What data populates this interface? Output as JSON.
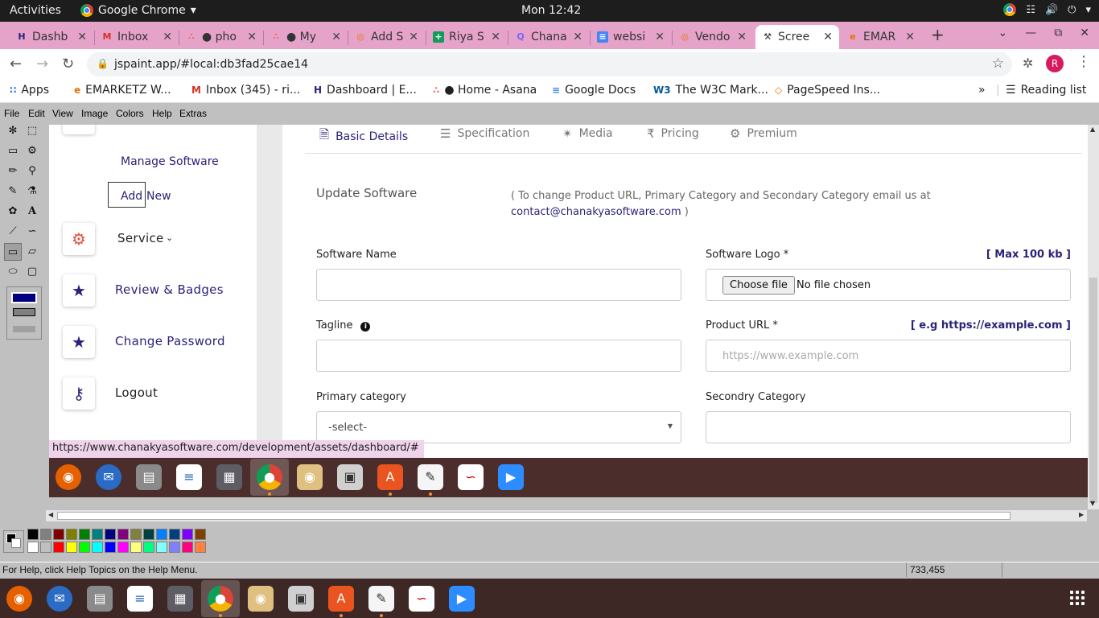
{
  "topbar": {
    "activities": "Activities",
    "app_name": "Google Chrome",
    "clock": "Mon 12:42",
    "tray": [
      "network-icon",
      "volume-icon",
      "power-icon"
    ]
  },
  "tabs": [
    {
      "label": "Dashb",
      "icon": "H",
      "color": "#2a237a"
    },
    {
      "label": "Inbox",
      "icon": "M",
      "color": "#d93025"
    },
    {
      "label": "● pho",
      "icon": "∴",
      "color": "#f06a6a"
    },
    {
      "label": "● My",
      "icon": "∴",
      "color": "#f06a6a"
    },
    {
      "label": "Add S",
      "icon": "◎",
      "color": "#e8710a"
    },
    {
      "label": "Riya S",
      "icon": "+",
      "color": "#0f9d58"
    },
    {
      "label": "Chana",
      "icon": "Q",
      "color": "#7b61ff"
    },
    {
      "label": "websi",
      "icon": "≡",
      "color": "#4285f4"
    },
    {
      "label": "Vendo",
      "icon": "◎",
      "color": "#e8710a"
    },
    {
      "label": "Scree",
      "icon": "⚒",
      "color": "#333333"
    },
    {
      "label": "EMAR",
      "icon": "e",
      "color": "#e8710a"
    }
  ],
  "address": {
    "url": "jspaint.app/#local:db3fad25cae14",
    "avatar_letter": "R"
  },
  "bookmarks": [
    {
      "label": "Apps",
      "icon": "∷"
    },
    {
      "label": "EMARKETZ W...",
      "icon": "e"
    },
    {
      "label": "Inbox (345) - ri...",
      "icon": "M"
    },
    {
      "label": "Dashboard | E...",
      "icon": "H"
    },
    {
      "label": "● Home - Asana",
      "icon": "∴"
    },
    {
      "label": "Google Docs",
      "icon": "≡"
    },
    {
      "label": "The W3C Mark...",
      "icon": "W3"
    },
    {
      "label": "PageSpeed Ins...",
      "icon": "◇"
    }
  ],
  "reading_list": "Reading list",
  "paint_menu": [
    "File",
    "Edit",
    "View",
    "Image",
    "Colors",
    "Help",
    "Extras"
  ],
  "site": {
    "sidebar": {
      "manage_software": "Manage Software",
      "add": "Add",
      "new": "New",
      "items": [
        {
          "label": "Service",
          "icon": "gears-icon"
        },
        {
          "label": "Review & Badges",
          "icon": "star-icon"
        },
        {
          "label": "Change Password",
          "icon": "star-icon"
        },
        {
          "label": "Logout",
          "icon": "key-icon"
        }
      ],
      "service_caret": "⌵"
    },
    "tabs": [
      {
        "label": "Basic Details",
        "icon": "🗎"
      },
      {
        "label": "Specification",
        "icon": "☰"
      },
      {
        "label": "Media",
        "icon": "✴"
      },
      {
        "label": "Pricing",
        "icon": "₹"
      },
      {
        "label": "Premium",
        "icon": "⚙"
      }
    ],
    "update_title": "Update Software",
    "update_note": "( To change Product URL, Primary Category and Secondary Category email us at",
    "update_email": "contact@chanakyasoftware.com",
    "update_note_end": ")",
    "form": {
      "software_name_label": "Software Name",
      "software_logo_label": "Software Logo *",
      "software_logo_hint": "[ Max 100 kb ]",
      "choose_file": "Choose file",
      "no_file": "No file chosen",
      "tagline_label": "Tagline",
      "product_url_label": "Product URL *",
      "product_url_hint": "[ e.g https://example.com ]",
      "product_url_placeholder": "https://www.example.com",
      "primary_category_label": "Primary category",
      "primary_category_value": "-select-",
      "secondary_category_label": "Secondry Category"
    },
    "status_link": "https://www.chanakyasoftware.com/development/assets/dashboard/#"
  },
  "palette_colors": [
    [
      "#000000",
      "#808080",
      "#800000",
      "#808000",
      "#008000",
      "#008080",
      "#000080",
      "#800080",
      "#808040",
      "#004040",
      "#0080ff",
      "#004080",
      "#8000ff",
      "#804000"
    ],
    [
      "#ffffff",
      "#c0c0c0",
      "#ff0000",
      "#ffff00",
      "#00ff00",
      "#00ffff",
      "#0000ff",
      "#ff00ff",
      "#ffff80",
      "#00ff80",
      "#80ffff",
      "#8080ff",
      "#ff0080",
      "#ff8040"
    ]
  ],
  "paint_status": {
    "message": "For Help, click Help Topics on the Help Menu.",
    "coords": "733,455"
  },
  "dock_apps": [
    "firefox-icon",
    "thunderbird-icon",
    "files-icon",
    "writer-icon",
    "calculator-icon",
    "chrome-icon",
    "rhythmbox-icon",
    "camera-icon",
    "software-icon",
    "text-editor-icon",
    "evince-icon",
    "zoom-icon"
  ]
}
